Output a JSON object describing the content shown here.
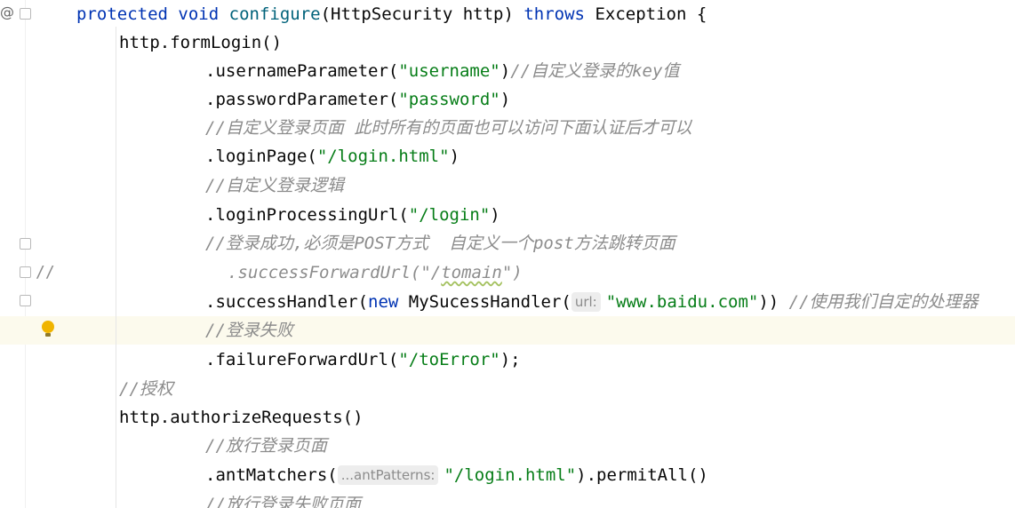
{
  "gutter": {
    "annotation_marker": "@",
    "commented_marker": "//"
  },
  "code": {
    "l1": {
      "kw1": "protected",
      "kw2": "void",
      "fn": "configure",
      "p1": "(HttpSecurity http) ",
      "kw3": "throws",
      "p2": " Exception {"
    },
    "l2": {
      "p": "http.formLogin()"
    },
    "l3": {
      "p1": ".usernameParameter(",
      "s": "\"username\"",
      "p2": ")",
      "c": "//自定义登录的key值"
    },
    "l4": {
      "p1": ".passwordParameter(",
      "s": "\"password\"",
      "p2": ")"
    },
    "l5": {
      "c": "//自定义登录页面 此时所有的页面也可以访问下面认证后才可以"
    },
    "l6": {
      "p1": ".loginPage(",
      "s": "\"/login.html\"",
      "p2": ")"
    },
    "l7": {
      "c": "//自定义登录逻辑"
    },
    "l8": {
      "p1": ".loginProcessingUrl(",
      "s": "\"/login\"",
      "p2": ")"
    },
    "l9": {
      "c": "//登录成功,必须是POST方式  自定义一个post方法跳转页面"
    },
    "l10": {
      "c1": ".successForwardUrl(\"/",
      "c2": "tomain",
      "c3": "\")"
    },
    "l11": {
      "p1": ".successHandler(",
      "kw": "new",
      "p2": " MySucessHandler(",
      "hint": "url:",
      "s": "\"www.baidu.com\"",
      "p3": ")) ",
      "c": "//使用我们自定的处理器"
    },
    "l12": {
      "c": "//登录失败"
    },
    "l13": {
      "p1": ".failureForwardUrl(",
      "s": "\"/toError\"",
      "p2": ");"
    },
    "l14": {
      "c": "//授权"
    },
    "l15": {
      "p": "http.authorizeRequests()"
    },
    "l16": {
      "c": "//放行登录页面"
    },
    "l17": {
      "p1": ".antMatchers(",
      "hint": "...antPatterns:",
      "s": "\"/login.html\"",
      "p2": ").permitAll()"
    },
    "l18": {
      "c": "//放行登录失败页面"
    }
  },
  "colors": {
    "keyword": "#0033b3",
    "method": "#00627a",
    "string": "#067d17",
    "comment": "#8c8c8c",
    "current_line": "#fcfaed"
  },
  "icons": [
    "annotation-marker",
    "fold-marker",
    "lightbulb-icon"
  ]
}
